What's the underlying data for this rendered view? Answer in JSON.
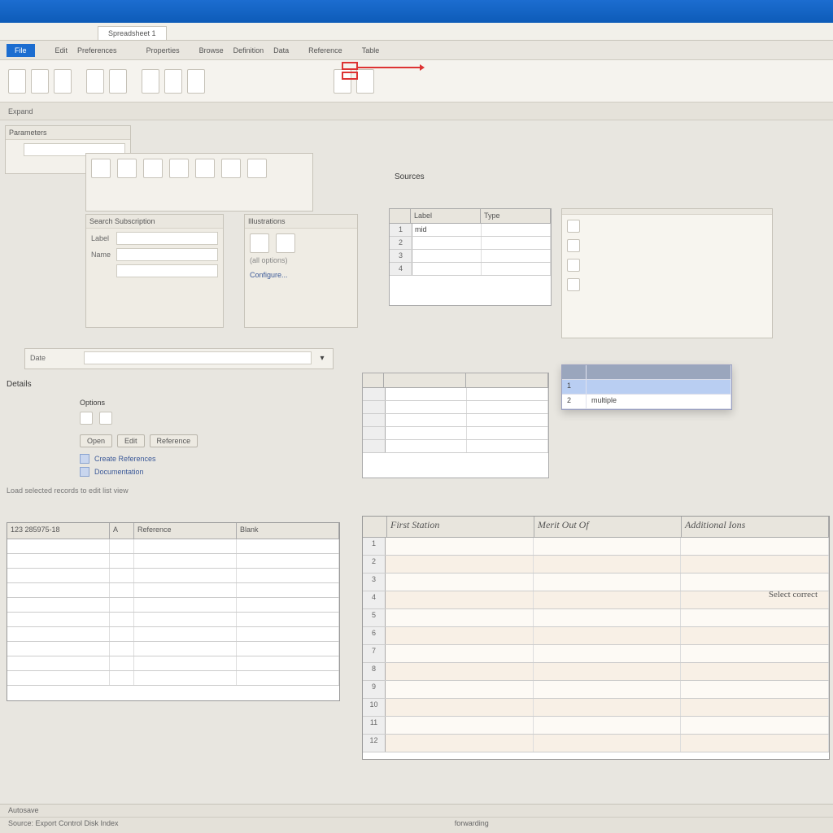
{
  "titlebar": {
    "left": "",
    "right_items": [
      "",
      ""
    ]
  },
  "tabs": {
    "active": "Spreadsheet 1"
  },
  "menubar": {
    "left_block": "File",
    "items": [
      "Edit",
      "Preferences",
      "",
      "",
      "Properties",
      "",
      "Browse",
      "Definition",
      "Data",
      "",
      "Reference",
      "",
      "Table"
    ]
  },
  "sec_bar": {
    "left": "Expand",
    "right": ""
  },
  "panels": {
    "nav_title": "Parameters",
    "tool_palette": {
      "labels": [
        "",
        "",
        "",
        "",
        ""
      ]
    },
    "form": {
      "title": "Search Subscription",
      "fields": [
        {
          "label": "Label",
          "value": ""
        },
        {
          "label": "Name",
          "value": ""
        },
        {
          "label": "",
          "value": ""
        }
      ]
    },
    "options": {
      "title": "Illustrations",
      "note": "(all options)",
      "link": "Configure..."
    },
    "sources_title": "Sources",
    "combo": {
      "label": "Date",
      "value": ""
    },
    "middle_title": "Details",
    "filters_title": "Options",
    "buttons": [
      "Open",
      "Edit",
      "Reference"
    ],
    "links": [
      {
        "label": "Create References"
      },
      {
        "label": "Documentation"
      }
    ],
    "note_line": "Load selected records to edit list view"
  },
  "sources_table": {
    "headers": [
      "",
      "Label",
      "Type"
    ],
    "rows": [
      [
        "1",
        "mid",
        ""
      ],
      [
        "2",
        "",
        ""
      ],
      [
        "3",
        "",
        ""
      ],
      [
        "4",
        "",
        ""
      ]
    ]
  },
  "preview_note": "",
  "popup": {
    "headers": [
      "",
      ""
    ],
    "rows": [
      [
        "1",
        ""
      ],
      [
        "2",
        "multiple"
      ]
    ]
  },
  "left_sheet": {
    "headers": [
      "123 285975-18",
      "A",
      "Reference",
      "Blank"
    ],
    "row_count": 10
  },
  "right_sheet": {
    "headers": [
      "",
      "First Station",
      "Merit Out Of",
      "Additional Ions"
    ],
    "side_note1": "Select correct",
    "side_note2": "",
    "row_count": 12
  },
  "popup_tab": "",
  "statusbar": {
    "tabs": [
      "Autosave"
    ],
    "info_left": "Source: Export Control Disk Index",
    "info_center": "forwarding",
    "info_right": ""
  }
}
